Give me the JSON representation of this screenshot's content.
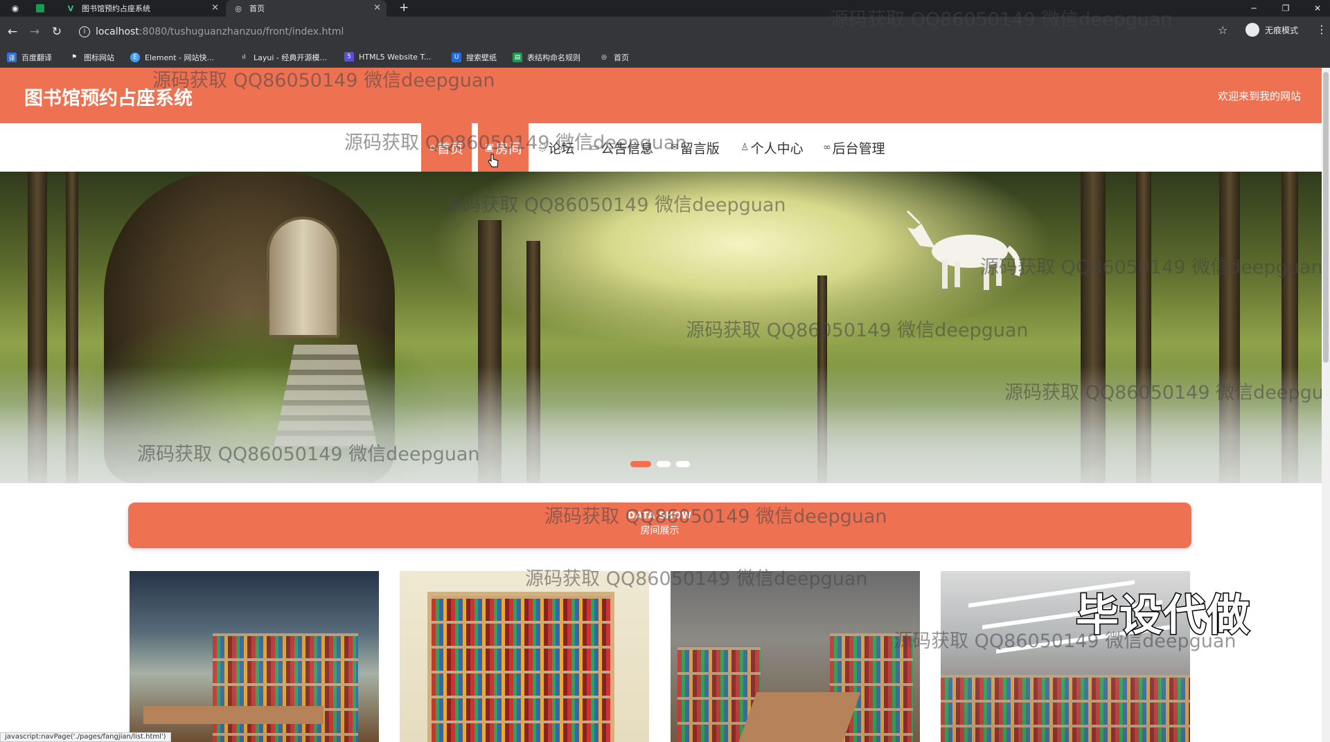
{
  "browser": {
    "tabs": [
      {
        "title": "图书馆预约占座系统",
        "active": false
      },
      {
        "title": "首页",
        "active": true
      }
    ],
    "new_tab": "+",
    "url_host": "localhost",
    "url_path": ":8080/tushuguanzhanzuo/front/index.html",
    "profile_label": "无痕模式",
    "bookmarks": [
      "百度翻译",
      "图标网站",
      "Element - 网站快...",
      "Layui - 经典开源模...",
      "HTML5 Website T...",
      "搜索壁纸",
      "表结构命名规则",
      "首页"
    ]
  },
  "site": {
    "title": "图书馆预约占座系统",
    "welcome": "欢迎来到我的网站",
    "nav": [
      {
        "label": "首页",
        "icon": "home-icon",
        "state": "active"
      },
      {
        "label": "房间",
        "icon": "room-icon",
        "state": "hover"
      },
      {
        "label": "论坛",
        "icon": "forum-icon",
        "state": "normal"
      },
      {
        "label": "公告信息",
        "icon": "notice-icon",
        "state": "normal"
      },
      {
        "label": "留言版",
        "icon": "message-icon",
        "state": "normal"
      },
      {
        "label": "个人中心",
        "icon": "user-icon",
        "state": "normal"
      },
      {
        "label": "后台管理",
        "icon": "link-icon",
        "state": "normal"
      }
    ],
    "carousel": {
      "slides": 3,
      "active_index": 0
    },
    "section": {
      "title_en": "DATA SHOW",
      "title_cn": "房间展示"
    },
    "rooms_count": 4
  },
  "watermark_text": "源码获取 QQ86050149 微信deepguan",
  "overlay_text": "毕设代做",
  "status_text": "javascript:navPage('./pages/fangjian/list.html')",
  "colors": {
    "brand": "#ee7152",
    "chrome_dark": "#202124",
    "chrome_mid": "#35363a"
  }
}
